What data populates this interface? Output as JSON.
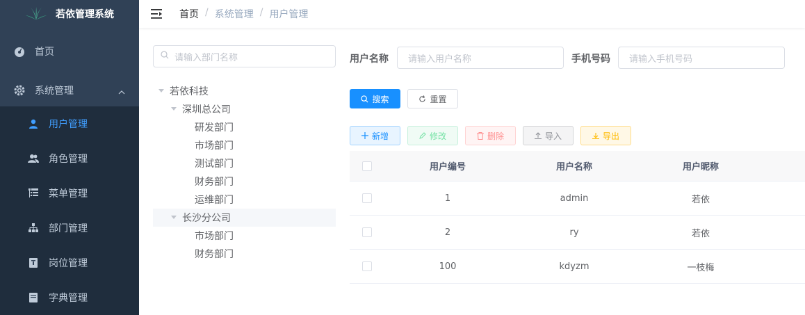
{
  "app": {
    "title": "若依管理系统"
  },
  "sidebar": {
    "items": [
      {
        "label": "首页",
        "icon": "dashboard-icon"
      },
      {
        "label": "系统管理",
        "icon": "gear-icon",
        "expanded": true
      }
    ],
    "submenu": [
      {
        "label": "用户管理",
        "icon": "user-icon",
        "active": true
      },
      {
        "label": "角色管理",
        "icon": "users-icon"
      },
      {
        "label": "菜单管理",
        "icon": "tree-table-icon"
      },
      {
        "label": "部门管理",
        "icon": "org-icon"
      },
      {
        "label": "岗位管理",
        "icon": "post-icon"
      },
      {
        "label": "字典管理",
        "icon": "dict-icon"
      }
    ]
  },
  "breadcrumb": [
    "首页",
    "系统管理",
    "用户管理"
  ],
  "tree": {
    "placeholder": "请输入部门名称",
    "nodes": [
      {
        "label": "若依科技",
        "level": 0,
        "expanded": true
      },
      {
        "label": "深圳总公司",
        "level": 1,
        "expanded": true
      },
      {
        "label": "研发部门",
        "level": 2
      },
      {
        "label": "市场部门",
        "level": 2
      },
      {
        "label": "测试部门",
        "level": 2
      },
      {
        "label": "财务部门",
        "level": 2
      },
      {
        "label": "运维部门",
        "level": 2
      },
      {
        "label": "长沙分公司",
        "level": 1,
        "expanded": true,
        "selected": true
      },
      {
        "label": "市场部门",
        "level": 2
      },
      {
        "label": "财务部门",
        "level": 2
      }
    ]
  },
  "filters": {
    "username_label": "用户名称",
    "username_placeholder": "请输入用户名称",
    "phone_label": "手机号码",
    "phone_placeholder": "请输入手机号码"
  },
  "actions": {
    "search": "搜索",
    "reset": "重置",
    "add": "新增",
    "edit": "修改",
    "delete": "删除",
    "import": "导入",
    "export": "导出"
  },
  "table": {
    "columns": [
      "用户编号",
      "用户名称",
      "用户昵称"
    ],
    "rows": [
      [
        "1",
        "admin",
        "若依"
      ],
      [
        "2",
        "ry",
        "若依"
      ],
      [
        "100",
        "kdyzm",
        "一枝梅"
      ]
    ]
  },
  "colors": {
    "sidebar": "#304156",
    "primary": "#1890ff",
    "active": "#409eff"
  }
}
